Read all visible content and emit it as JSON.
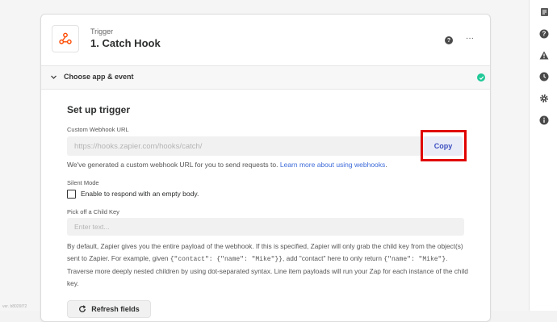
{
  "header": {
    "kicker": "Trigger",
    "title": "1. Catch Hook",
    "help_glyph": "?",
    "more_glyph": "···",
    "icon": "webhook-icon"
  },
  "section": {
    "label": "Choose app & event",
    "status": "complete"
  },
  "setup": {
    "title": "Set up trigger",
    "webhook_label": "Custom Webhook URL",
    "webhook_url": "https://hooks.zapier.com/hooks/catch/",
    "copy_label": "Copy",
    "help_text": "We've generated a custom webhook URL for you to send requests to. ",
    "help_link": "Learn more about using webhooks",
    "help_end": ".",
    "silent_mode_label": "Silent Mode",
    "silent_mode_checkbox": "Enable to respond with an empty body.",
    "child_key_label": "Pick off a Child Key",
    "child_key_placeholder": "Enter text...",
    "description": {
      "part1": "By default, Zapier gives you the entire payload of the webhook. If this is specified, Zapier will only grab the child key from the object(s) sent to Zapier. For example, given ",
      "code1": "{\"contact\": {\"name\": \"Mike\"}}",
      "part2": ", add \"contact\" here to only return ",
      "code2": "{\"name\": \"Mike\"}",
      "part3": ". Traverse more deeply nested children by using dot-separated syntax. Line item payloads will run your Zap for each instance of the child key."
    },
    "refresh_label": "Refresh fields"
  },
  "right_rail": [
    "details-icon",
    "help-icon",
    "alert-icon",
    "history-icon",
    "settings-icon",
    "info-icon"
  ],
  "footer": {
    "version": "ver. b8026f72"
  },
  "colors": {
    "accent": "#3d4ec0",
    "link": "#3d6bd9",
    "success": "#20c997",
    "highlight": "#e00000",
    "brand_orange": "#ff4a00"
  }
}
